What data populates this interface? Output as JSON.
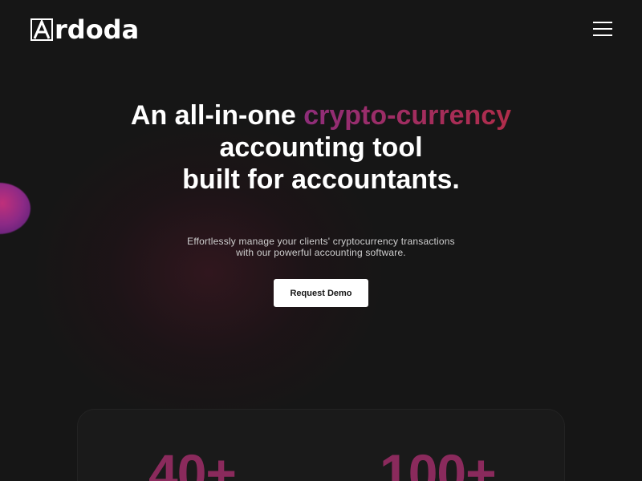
{
  "header": {
    "logo_text": "rdoda",
    "logo_mark_letter": "A",
    "menu_icon": "hamburger-menu-icon"
  },
  "hero": {
    "title_part1": "An all-in-one ",
    "title_accent": "crypto-currency",
    "title_line2": "accounting tool",
    "title_line3": "built for accountants.",
    "subtitle_line1": "Effortlessly manage your clients' cryptocurrency transactions",
    "subtitle_line2": "with our powerful accounting software.",
    "cta_label": "Request Demo"
  },
  "stats": [
    {
      "value": "40+"
    },
    {
      "value": "100+"
    }
  ],
  "colors": {
    "background": "#161616",
    "accent_start": "#8e2d7a",
    "accent_end": "#b02d4a",
    "stat_color": "#8a2a5c",
    "button_bg": "#ffffff",
    "button_text": "#141414"
  }
}
